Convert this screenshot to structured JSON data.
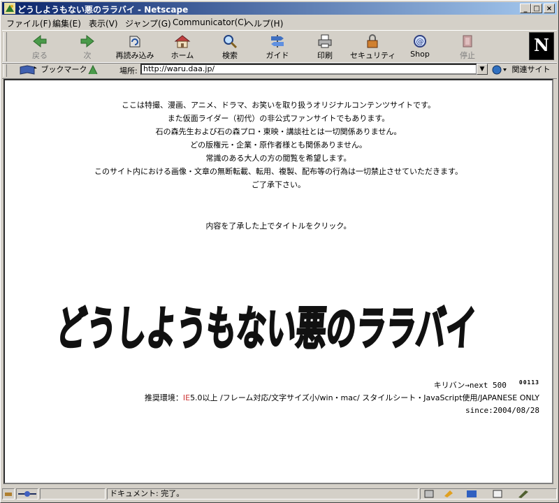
{
  "window": {
    "title": "どうしようもない悪のララバイ - Netscape",
    "controls": [
      "_",
      "□",
      "×"
    ]
  },
  "menu": [
    "ファイル(F)",
    "編集(E)",
    "表示(V)",
    "ジャンプ(G)",
    "Communicator(C)",
    "ヘルプ(H)"
  ],
  "toolbar": {
    "back": "戻る",
    "forward": "次",
    "reload": "再読み込み",
    "home": "ホーム",
    "search": "検索",
    "guide": "ガイド",
    "print": "印刷",
    "security": "セキュリティ",
    "shop": "Shop",
    "stop": "停止",
    "logo": "N"
  },
  "location": {
    "bookmarks": "ブックマーク",
    "label": "場所:",
    "url": "http://waru.daa.jp/",
    "related": "関連サイト"
  },
  "page": {
    "intro": [
      "ここは特撮、漫画、アニメ、ドラマ、お笑いを取り扱うオリジナルコンテンツサイトです。",
      "また仮面ライダー（初代）の非公式ファンサイトでもあります。",
      "石の森先生および石の森プロ・東映・講談社とは一切関係ありません。",
      "どの版権元・企業・原作者様とも関係ありません。",
      "常識のある大人の方の閲覧を希望します。",
      "このサイト内における画像・文章の無断転載、転用、複製、配布等の行為は一切禁止させていただきます。",
      "ご了承下さい。"
    ],
    "instruction": "内容を了承した上でタイトルをクリック。",
    "logo_text": "どうしようもない悪のララバイ",
    "kiriban": "キリバン→next 500",
    "counter": "00113",
    "env_prefix": "推奨環境：",
    "env_ie": "IE",
    "env_rest": "5.0以上 /フレーム対応/文字サイズ小/win・mac/ スタイルシート・JavaScript使用/JAPANESE ONLY",
    "since": "since:2004/08/28"
  },
  "status": {
    "text": "ドキュメント: 完了。"
  }
}
